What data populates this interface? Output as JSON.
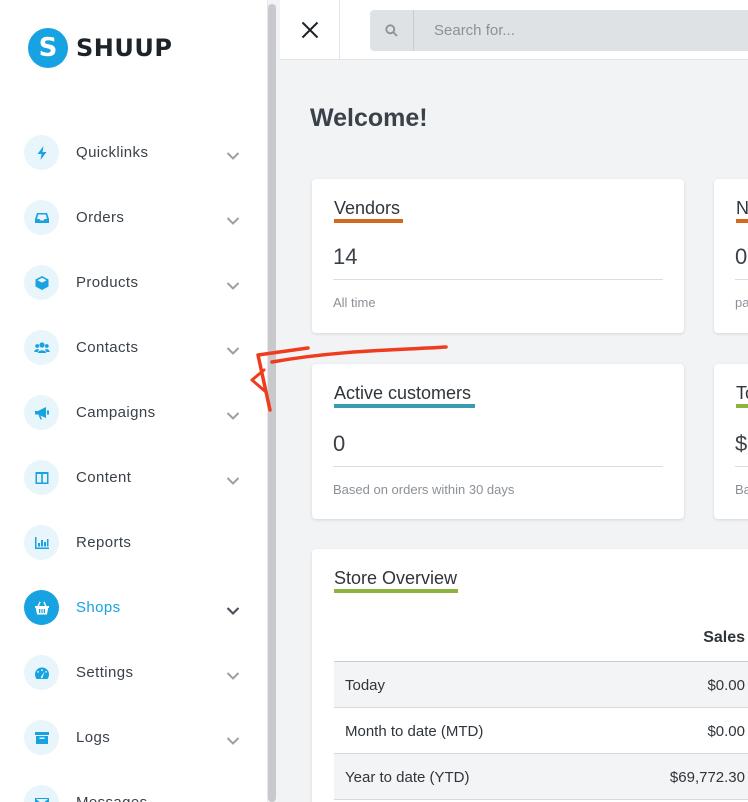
{
  "brand": {
    "name": "SHUUP",
    "mark": "S"
  },
  "sidebar": {
    "items": [
      {
        "label": "Quicklinks",
        "icon": "bolt-icon",
        "has_chevron": true
      },
      {
        "label": "Orders",
        "icon": "inbox-icon",
        "has_chevron": true
      },
      {
        "label": "Products",
        "icon": "cube-icon",
        "has_chevron": true
      },
      {
        "label": "Contacts",
        "icon": "users-icon",
        "has_chevron": true
      },
      {
        "label": "Campaigns",
        "icon": "bullhorn-icon",
        "has_chevron": true
      },
      {
        "label": "Content",
        "icon": "columns-icon",
        "has_chevron": true
      },
      {
        "label": "Reports",
        "icon": "bar-chart-icon",
        "has_chevron": false
      },
      {
        "label": "Shops",
        "icon": "basket-icon",
        "has_chevron": true,
        "active": true
      },
      {
        "label": "Settings",
        "icon": "dashboard-icon",
        "has_chevron": true
      },
      {
        "label": "Logs",
        "icon": "archive-icon",
        "has_chevron": true
      },
      {
        "label": "Messages",
        "icon": "envelope-icon",
        "has_chevron": false
      }
    ]
  },
  "topbar": {
    "search_placeholder": "Search for..."
  },
  "main": {
    "welcome": "Welcome!",
    "cards": {
      "vendors": {
        "title": "Vendors",
        "value": "14",
        "sub": "All time",
        "color": "#d2691e"
      },
      "n_card": {
        "title": "N",
        "value": "0",
        "sub": "pa",
        "color": "#d2691e"
      },
      "active_customers": {
        "title": "Active customers",
        "value": "0",
        "sub": "Based on orders within 30 days",
        "color": "#3a9bad"
      },
      "t_card": {
        "title": "To",
        "value": "$",
        "sub": "Ba",
        "color": "#8cb43c"
      }
    },
    "store_overview": {
      "title": "Store Overview",
      "color": "#8cb43c",
      "header_sales": "Sales",
      "rows": [
        {
          "label": "Today",
          "sales": "$0.00"
        },
        {
          "label": "Month to date (MTD)",
          "sales": "$0.00"
        },
        {
          "label": "Year to date (YTD)",
          "sales": "$69,772.30"
        }
      ]
    }
  },
  "colors": {
    "accent": "#17a2e2",
    "annotation": "#f03c1e"
  }
}
